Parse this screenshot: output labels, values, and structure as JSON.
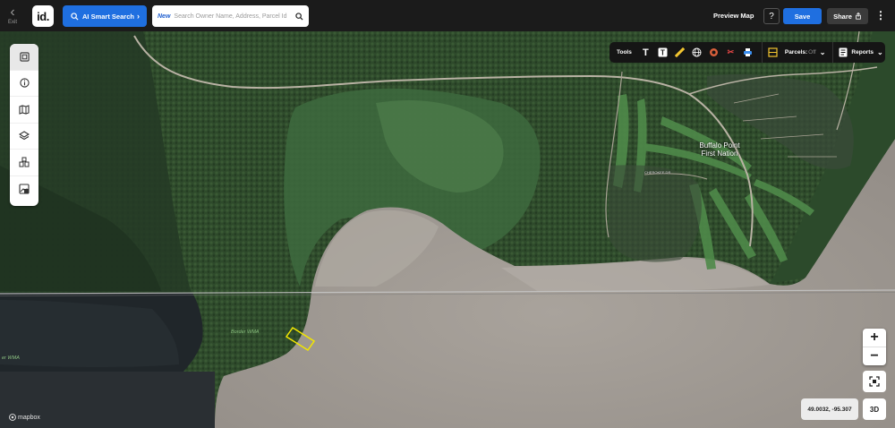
{
  "header": {
    "exit_label": "Exit",
    "logo_text": "id.",
    "ai_search_label": "AI Smart Search",
    "search_new_tag": "New",
    "search_placeholder": "Search Owner Name, Address, Parcel Id",
    "preview_map_label": "Preview Map",
    "help_label": "?",
    "save_label": "Save",
    "share_label": "Share"
  },
  "toolbar": {
    "tools_label": "Tools",
    "parcels_label": "Parcels:",
    "parcels_state": "Off",
    "reports_label": "Reports"
  },
  "map": {
    "place_label_line1": "Buffalo Point",
    "place_label_line2": "First Nation",
    "road_label": "CHEROKEE DR",
    "wma_label_1": "Border WMA",
    "wma_label_2": "er WMA",
    "coordinates": "49.0032, -95.307",
    "btn_3d": "3D",
    "attribution": "mapbox"
  },
  "colors": {
    "accent": "#1f6fe0",
    "parcel_outline": "#f2e600",
    "water": "#8e8a86",
    "forest": "#2d4a2a"
  },
  "icons": [
    "back-chevron-icon",
    "search-icon",
    "panel-icon",
    "info-icon",
    "map-book-icon",
    "layers-icon",
    "buildings-icon",
    "image-export-icon",
    "text-icon",
    "text-box-icon",
    "ruler-icon",
    "globe-icon",
    "circle-icon",
    "scissors-icon",
    "print-icon",
    "parcels-icon",
    "reports-icon",
    "share-icon"
  ]
}
